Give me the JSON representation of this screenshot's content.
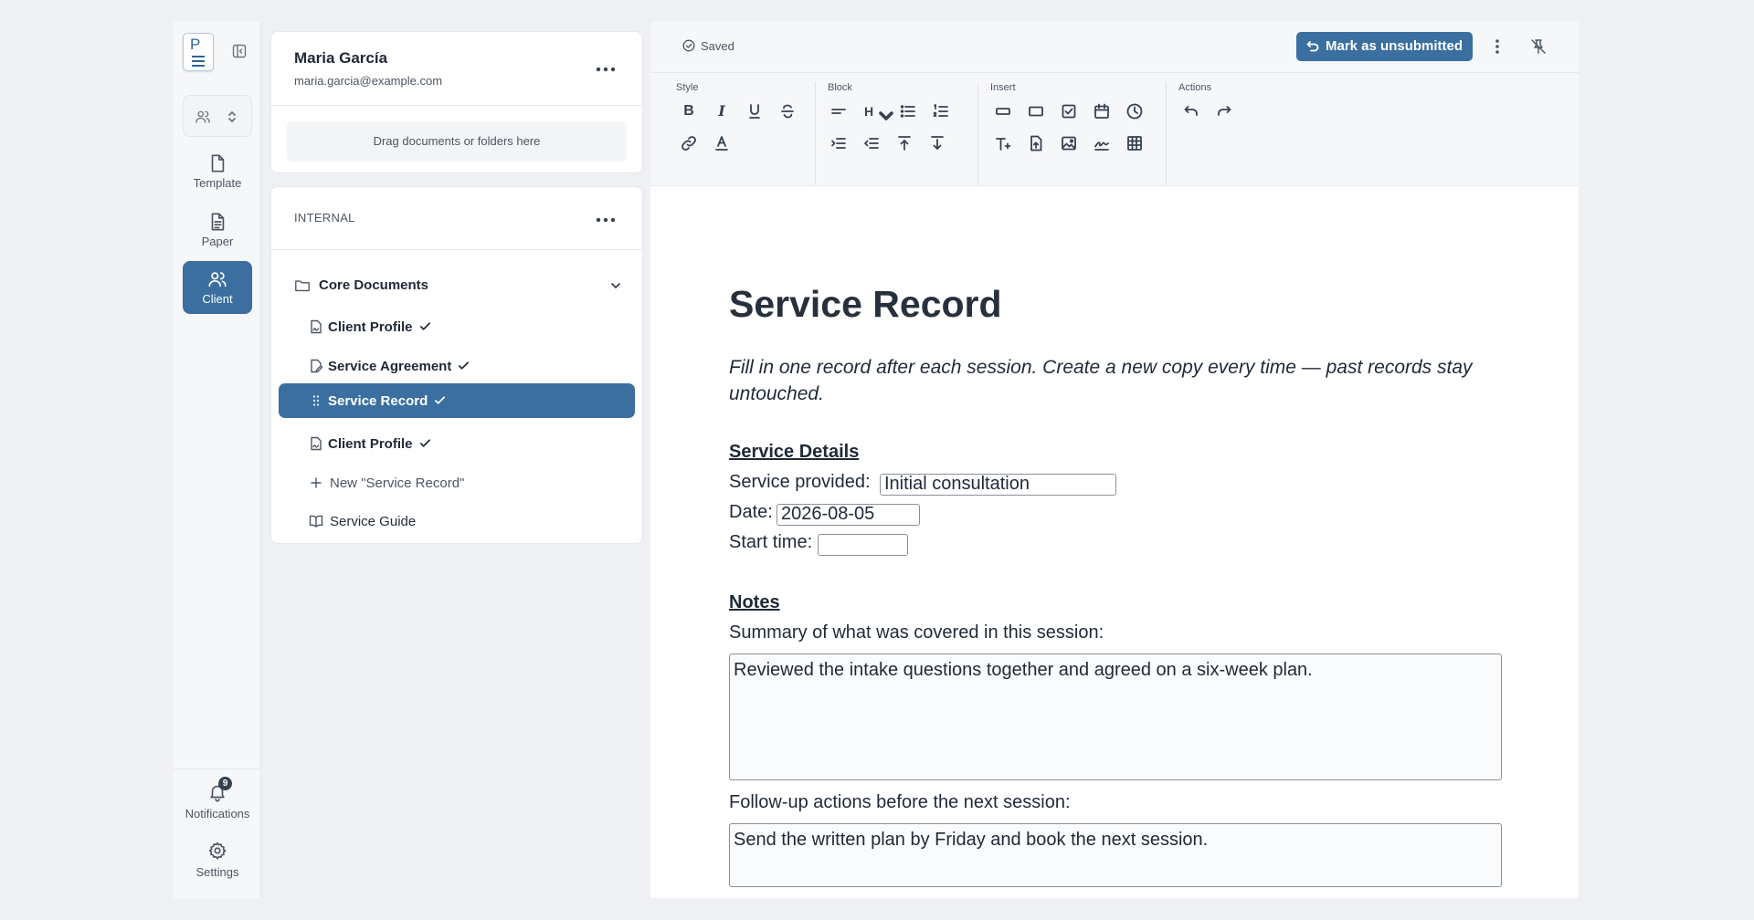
{
  "rail": {
    "logo_letter": "P",
    "items": [
      {
        "label": "Template",
        "icon": "file-icon"
      },
      {
        "label": "Paper",
        "icon": "document-text-icon"
      },
      {
        "label": "Client",
        "icon": "users-icon",
        "active": true
      }
    ],
    "notifications": {
      "label": "Notifications",
      "count": "9"
    },
    "settings": {
      "label": "Settings"
    }
  },
  "user": {
    "name": "Maria García",
    "email": "maria.garcia@example.com"
  },
  "dropzone": "Drag documents or folders here",
  "internal": {
    "section_title": "INTERNAL",
    "folder": "Core Documents",
    "documents": [
      {
        "label": "Client Profile",
        "icon": "file-signature-icon",
        "checked": true
      },
      {
        "label": "Service Agreement",
        "icon": "file-edit-icon",
        "checked": true
      },
      {
        "label": "Service Record",
        "icon": "drag-handle-icon",
        "checked": true,
        "active": true
      },
      {
        "label": "Client Profile",
        "icon": "file-signature-icon",
        "checked": true
      }
    ],
    "new_item": "New \"Service Record\"",
    "guide": "Service Guide"
  },
  "editor": {
    "saved": "Saved",
    "mark_button": "Mark as unsubmitted",
    "groups": {
      "style": "Style",
      "block": "Block",
      "insert": "Insert",
      "actions": "Actions"
    },
    "heading_tool": "H"
  },
  "document": {
    "title": "Service Record",
    "intro": "Fill in one record after each session. Create a new copy every time — past records stay untouched.",
    "service_details_heading": "Service Details",
    "service_provided_label": "Service provided:",
    "service_provided_value": "Initial consultation",
    "date_label": "Date:",
    "date_value": "2026-08-05",
    "start_time_label": "Start time:",
    "start_time_value": "",
    "notes_heading": "Notes",
    "summary_label": "Summary of what was covered in this session:",
    "summary_value": "Reviewed the intake questions together and agreed on a six-week plan.",
    "followup_label": "Follow-up actions before the next session:",
    "followup_value": "Send the written plan by Friday and book the next session."
  },
  "colors": {
    "accent": "#3a6f9f",
    "background": "#eef0f3",
    "text": "#1f2937"
  }
}
